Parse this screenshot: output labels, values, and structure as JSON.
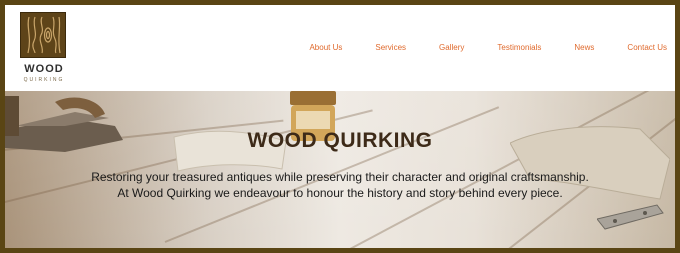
{
  "brand": {
    "name": "WOOD",
    "tagline": "QUIRKING"
  },
  "nav": {
    "items": [
      "About Us",
      "Services",
      "Gallery",
      "Testimonials",
      "News",
      "Contact Us"
    ]
  },
  "hero": {
    "title": "WOOD QUIRKING",
    "text": "Restoring your treasured antiques while preserving their character and original craftsmanship. At Wood Quirking we endeavour to honour the history and story behind every piece."
  },
  "colors": {
    "frame": "#5a4514",
    "nav_link": "#e06a2d",
    "logo_bg": "#5e4419",
    "title": "#3d2a18"
  },
  "icons": [
    "wood-grain-logo-icon"
  ]
}
